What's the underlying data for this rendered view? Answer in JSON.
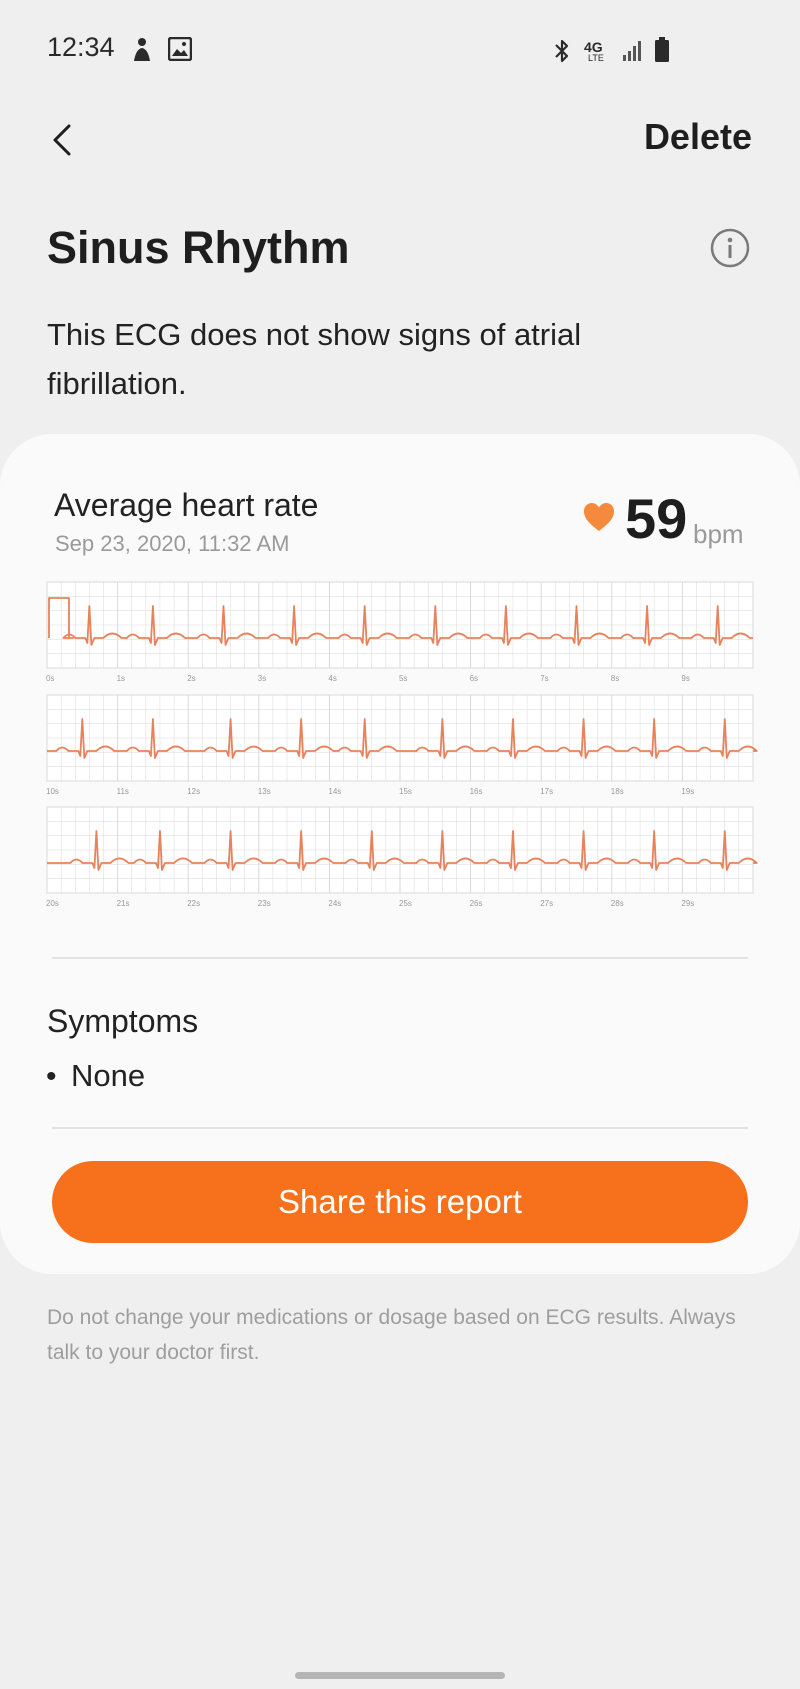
{
  "status_bar": {
    "time": "12:34",
    "icons": [
      "person-icon",
      "image-icon",
      "bluetooth-icon",
      "4g-lte-icon",
      "signal-icon",
      "battery-icon"
    ],
    "network_label": "4G",
    "network_sub": "LTE"
  },
  "header": {
    "back_icon": "chevron-left-icon",
    "delete_label": "Delete"
  },
  "result": {
    "title": "Sinus Rhythm",
    "info_icon": "info-icon",
    "description": "This ECG does not show signs of atrial fibrillation."
  },
  "heart_rate": {
    "label": "Average heart rate",
    "date": "Sep 23, 2020, 11:32 AM",
    "value": "59",
    "unit": "bpm",
    "icon": "heart-icon"
  },
  "chart_data": {
    "type": "line",
    "strips": [
      {
        "ticks": [
          "0s",
          "1s",
          "2s",
          "3s",
          "4s",
          "5s",
          "6s",
          "7s",
          "8s",
          "9s"
        ],
        "beats": [
          0.6,
          1.5,
          2.5,
          3.5,
          4.5,
          5.5,
          6.5,
          7.5,
          8.5,
          9.5
        ]
      },
      {
        "ticks": [
          "10s",
          "11s",
          "12s",
          "13s",
          "14s",
          "15s",
          "16s",
          "17s",
          "18s",
          "19s"
        ],
        "beats": [
          10.5,
          11.5,
          12.6,
          13.6,
          14.5,
          15.6,
          16.6,
          17.6,
          18.6,
          19.6
        ]
      },
      {
        "ticks": [
          "20s",
          "21s",
          "22s",
          "23s",
          "24s",
          "25s",
          "26s",
          "27s",
          "28s",
          "29s"
        ],
        "beats": [
          20.7,
          21.6,
          22.6,
          23.6,
          24.6,
          25.6,
          26.6,
          27.6,
          28.6,
          29.6
        ]
      }
    ],
    "series_color": "#e8825a",
    "grid_color": "#d9d9d9"
  },
  "symptoms": {
    "title": "Symptoms",
    "bullet": "•",
    "items": [
      "None"
    ]
  },
  "actions": {
    "share_label": "Share this report"
  },
  "disclaimer": "Do not change your medications or dosage based on ECG results. Always talk to your doctor first.",
  "colors": {
    "accent": "#f7711c",
    "heart": "#f68a3c",
    "background": "#efefef",
    "card": "#fafafa"
  }
}
